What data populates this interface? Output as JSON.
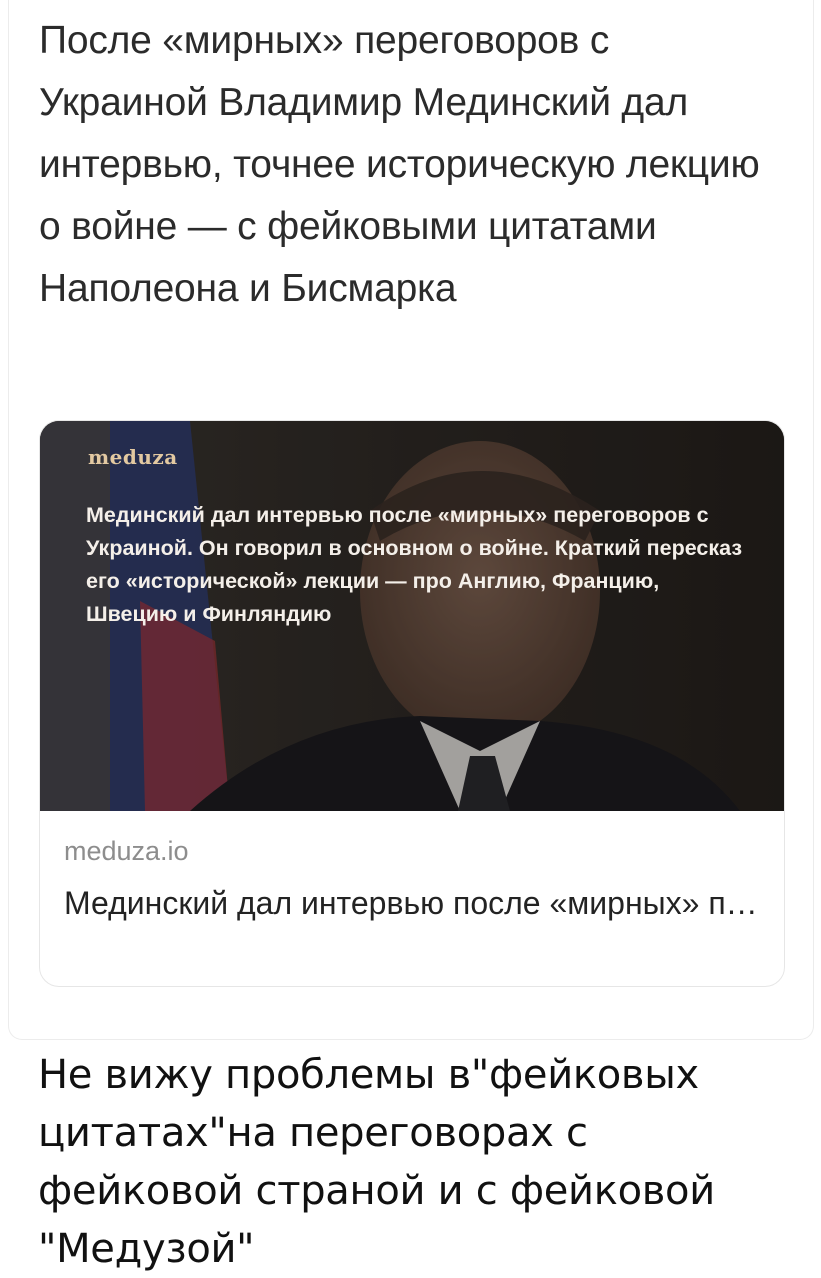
{
  "post": {
    "text": "После «мирных» переговоров с Украиной Владимир Мединский дал интервью, точнее историческую лекцию о войне — с фейковыми цитатами Наполеона и Бисмарка"
  },
  "link_preview": {
    "logo_text": "meduza",
    "image_overlay_text": "Мединский дал интервью после «мирных» переговоров с Украиной. Он говорил в основном о войне. Краткий пересказ его «исторической» лекции — про Англию, Францию, Швецию и Финляндию",
    "domain": "meduza.io",
    "title": "Мединский дал интервью после «мирных» переговоров с У..."
  },
  "comment": {
    "text": "Не вижу проблемы в\"фейковых цитатах\"на переговорах с фейковой страной и с фейковой \"Медузой\""
  },
  "colors": {
    "background": "#ffffff",
    "post_text": "#2b2b2b",
    "domain_text": "#8d8d8d",
    "logo": "#e3c9a1"
  }
}
